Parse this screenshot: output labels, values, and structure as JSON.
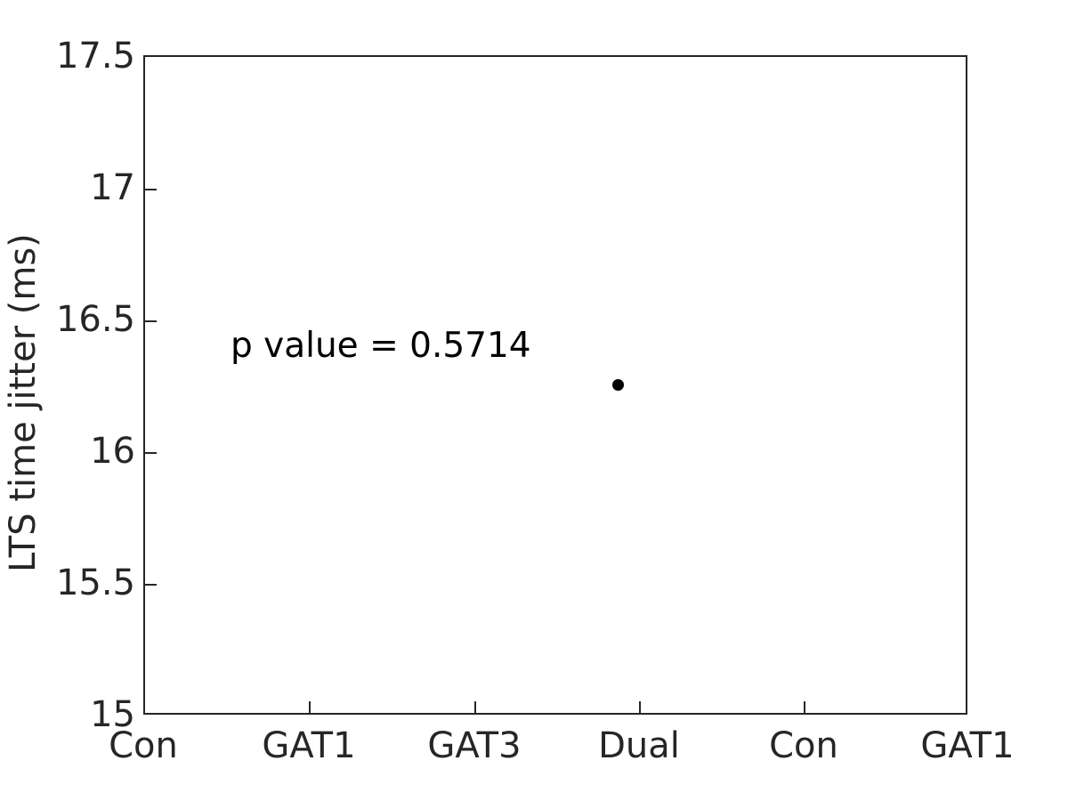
{
  "figure": {
    "background_color": "#ffffff",
    "axis_color": "#262626",
    "marker_color": "#000000"
  },
  "annotation": {
    "text": "p value = 0.5714"
  },
  "chart_data": {
    "type": "scatter",
    "title": "",
    "xlabel": "",
    "ylabel": "LTS time jitter (ms)",
    "categories": [
      "Con",
      "GAT1",
      "GAT3",
      "Dual",
      "Con",
      "GAT1"
    ],
    "x_tick_labels": [
      "Con",
      "GAT1",
      "GAT3",
      "Dual",
      "Con",
      "GAT1"
    ],
    "y_tick_labels": [
      "15",
      "15.5",
      "16",
      "16.5",
      "17",
      "17.5"
    ],
    "y_ticks": [
      15,
      15.5,
      16,
      16.5,
      17,
      17.5
    ],
    "ylim": [
      15,
      17.5
    ],
    "xlim": [
      0.5,
      6.5
    ],
    "grid": false,
    "legend": null,
    "series": [
      {
        "name": "LTS time jitter",
        "marker": "circle",
        "color": "#000000",
        "points": [
          {
            "category": "Dual",
            "x": 4,
            "y": 16.26
          }
        ]
      }
    ],
    "annotations": [
      {
        "text": "p value = 0.5714",
        "x": 1.55,
        "y": 16.7
      }
    ]
  }
}
